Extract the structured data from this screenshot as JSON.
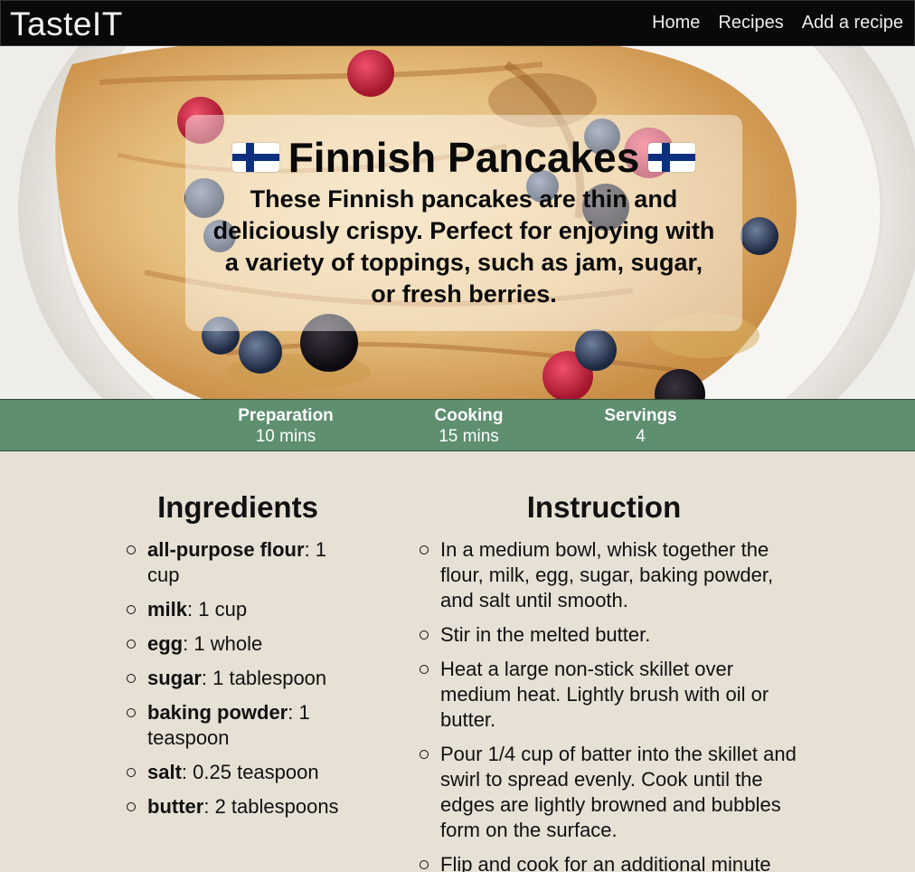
{
  "navbar": {
    "brand": "TasteIT",
    "links": [
      "Home",
      "Recipes",
      "Add a recipe"
    ]
  },
  "hero": {
    "title": "Finnish Pancakes",
    "description": "These Finnish pancakes are thin and deliciously crispy. Perfect for enjoying with a variety of toppings, such as jam, sugar, or fresh berries.",
    "flag_icon": "finland-flag-icon"
  },
  "stats": [
    {
      "label": "Preparation",
      "value": "10 mins"
    },
    {
      "label": "Cooking",
      "value": "15 mins"
    },
    {
      "label": "Servings",
      "value": "4"
    }
  ],
  "ingredients": {
    "title": "Ingredients",
    "items": [
      {
        "name": "all-purpose flour",
        "amount": "1 cup"
      },
      {
        "name": "milk",
        "amount": "1 cup"
      },
      {
        "name": "egg",
        "amount": "1 whole"
      },
      {
        "name": "sugar",
        "amount": "1 tablespoon"
      },
      {
        "name": "baking powder",
        "amount": "1 teaspoon"
      },
      {
        "name": "salt",
        "amount": "0.25 teaspoon"
      },
      {
        "name": "butter",
        "amount": "2 tablespoons"
      }
    ]
  },
  "instructions": {
    "title": "Instruction",
    "steps": [
      "In a medium bowl, whisk together the flour, milk, egg, sugar, baking powder, and salt until smooth.",
      "Stir in the melted butter.",
      "Heat a large non-stick skillet over medium heat. Lightly brush with oil or butter.",
      "Pour 1/4 cup of batter into the skillet and swirl to spread evenly. Cook until the edges are lightly browned and bubbles form on the surface.",
      "Flip and cook for an additional minute"
    ]
  },
  "colors": {
    "navbar": "#0a0909",
    "stats_bar": "#5e8f6f",
    "page_background": "#e6e0d5",
    "flag_blue": "#0d2f7d"
  }
}
